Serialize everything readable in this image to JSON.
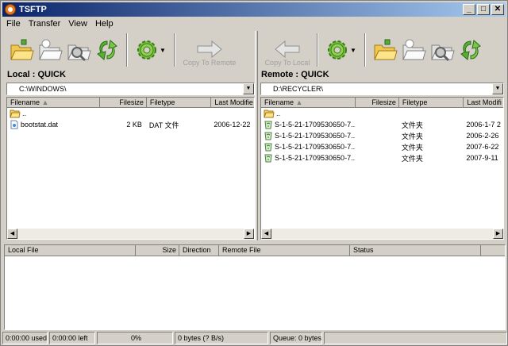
{
  "window": {
    "title": "TSFTP"
  },
  "menu": [
    "File",
    "Transfer",
    "View",
    "Help"
  ],
  "toolbar": {
    "copy_to_remote": "Copy To Remote",
    "copy_to_local": "Copy To Local"
  },
  "local": {
    "header": "Local : QUICK",
    "path": "C:\\WINDOWS\\",
    "columns": [
      "Filename",
      "Filesize",
      "Filetype",
      "Last Modifie"
    ],
    "rows": [
      {
        "name": "..",
        "size": "",
        "type": "",
        "modified": "",
        "icon": "folder-up"
      },
      {
        "name": "bootstat.dat",
        "size": "2 KB",
        "type": "DAT 文件",
        "modified": "2006-12-22",
        "icon": "file"
      }
    ]
  },
  "remote": {
    "header": "Remote : QUICK",
    "path": "D:\\RECYCLER\\",
    "columns": [
      "Filename",
      "Filesize",
      "Filetype",
      "Last Modifi"
    ],
    "rows": [
      {
        "name": "..",
        "size": "",
        "type": "",
        "modified": "",
        "icon": "folder-up"
      },
      {
        "name": "S-1-5-21-1709530650-7...",
        "size": "",
        "type": "文件夹",
        "modified": "2006-1-7 2",
        "icon": "recycle-folder"
      },
      {
        "name": "S-1-5-21-1709530650-7...",
        "size": "",
        "type": "文件夹",
        "modified": "2006-2-26",
        "icon": "recycle-folder"
      },
      {
        "name": "S-1-5-21-1709530650-7...",
        "size": "",
        "type": "文件夹",
        "modified": "2007-6-22",
        "icon": "recycle-folder"
      },
      {
        "name": "S-1-5-21-1709530650-7...",
        "size": "",
        "type": "文件夹",
        "modified": "2007-9-11",
        "icon": "recycle-folder"
      }
    ]
  },
  "queue": {
    "columns": [
      "Local File",
      "Size",
      "Direction",
      "Remote File",
      "Status"
    ]
  },
  "status": {
    "used": "0:00:00 used",
    "left": "0:00:00 left",
    "percent": "0%",
    "bytes": "0 bytes (? B/s)",
    "queue": "Queue: 0 bytes"
  }
}
